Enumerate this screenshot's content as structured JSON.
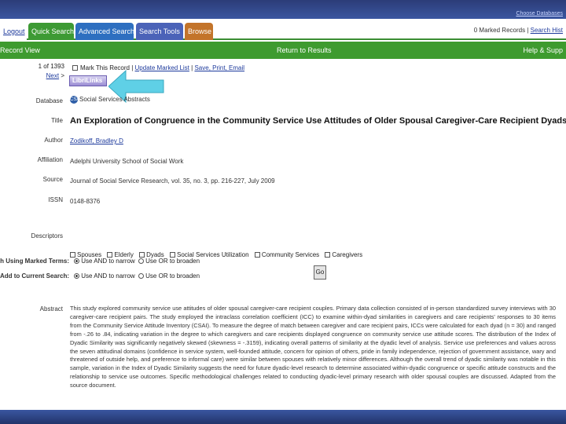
{
  "header": {
    "top_right_link": "Choose Databases"
  },
  "tabs": {
    "logout": "Logout",
    "quick_search": "Quick Search",
    "advanced_search": "Advanced Search",
    "search_tools": "Search Tools",
    "browse": "Browse",
    "marked_records": "0 Marked Records",
    "search_history": "Search Hist"
  },
  "greenbar": {
    "record_view": "Record View",
    "return_to_results": "Return to Results",
    "help_support": "Help & Supp"
  },
  "nav": {
    "count": "1 of 1393",
    "next": "Next"
  },
  "actions": {
    "mark": "Mark This Record",
    "update_marked": "Update Marked List",
    "save_print_email": "Save, Print, Email"
  },
  "librilinks_label": "LibriLinks",
  "record": {
    "database_label": "Database",
    "database_value": "Social Services Abstracts",
    "database_icon_text": "CSA",
    "title_label": "Title",
    "title_value": "An Exploration of Congruence in the Community Service Use Attitudes of Older Spousal Caregiver-Care Recipient Dyads",
    "author_label": "Author",
    "author_value": "Zodikoff, Bradley D",
    "affiliation_label": "Affiliation",
    "affiliation_value": "Adelphi University School of Social Work",
    "source_label": "Source",
    "source_value": "Journal of Social Service Research, vol. 35, no. 3, pp. 216-227, July 2009",
    "issn_label": "ISSN",
    "issn_value": "0148-8376",
    "descriptors_label": "Descriptors",
    "descriptors": [
      "Spouses",
      "Elderly",
      "Dyads",
      "Social Services Utilization",
      "Community Services",
      "Caregivers"
    ],
    "new_search_label": "New Search Using Marked Terms:",
    "add_to_search_label": "Add to Current Search:",
    "use_and": "Use AND to narrow",
    "use_or": "Use OR to broaden",
    "go": "Go",
    "abstract_label": "Abstract",
    "abstract_text": "This study explored community service use attitudes of older spousal caregiver-care recipient couples. Primary data collection consisted of in-person standardized survey interviews with 30 caregiver-care recipient pairs. The study employed the intraclass correlation coefficient (ICC) to examine within-dyad similarities in caregivers and care recipients' responses to 30 items from the Community Service Attitude Inventory (CSAI). To measure the degree of match between caregiver and care recipient pairs, ICCs were calculated for each dyad (n = 30) and ranged from -.26 to .84, indicating variation in the degree to which caregivers and care recipients displayed congruence on community service use attitude scores. The distribution of the Index of Dyadic Similarity was significantly negatively skewed (skewness = -.3159), indicating overall patterns of similarity at the dyadic level of analysis. Service use preferences and values across the seven attitudinal domains (confidence in service system, well-founded attitude, concern for opinion of others, pride in family independence, rejection of government assistance, wary and threatened of outside help, and preference to informal care) were similar between spouses with relatively minor differences. Although the overall trend of dyadic similarity was notable in this sample, variation in the Index of Dyadic Similarity suggests the need for future dyadic-level research to determine associated within-dyadic congruence or specific attitude constructs and the relationship to service use outcomes. Specific methodological challenges related to conducting dyadic-level primary research with older spousal couples are discussed. Adapted from the source document."
  },
  "colors": {
    "green_bar": "#3e9b2f",
    "quick_search_tab": "#3d9a34",
    "advanced_search_tab": "#2e6fc0",
    "search_tools_tab": "#4b63b8",
    "browse_tab": "#c3742a",
    "link": "#1d3a9c",
    "arrow": "#5fd0e6"
  },
  "icons": [
    "database-icon",
    "pointer-arrow-icon"
  ]
}
